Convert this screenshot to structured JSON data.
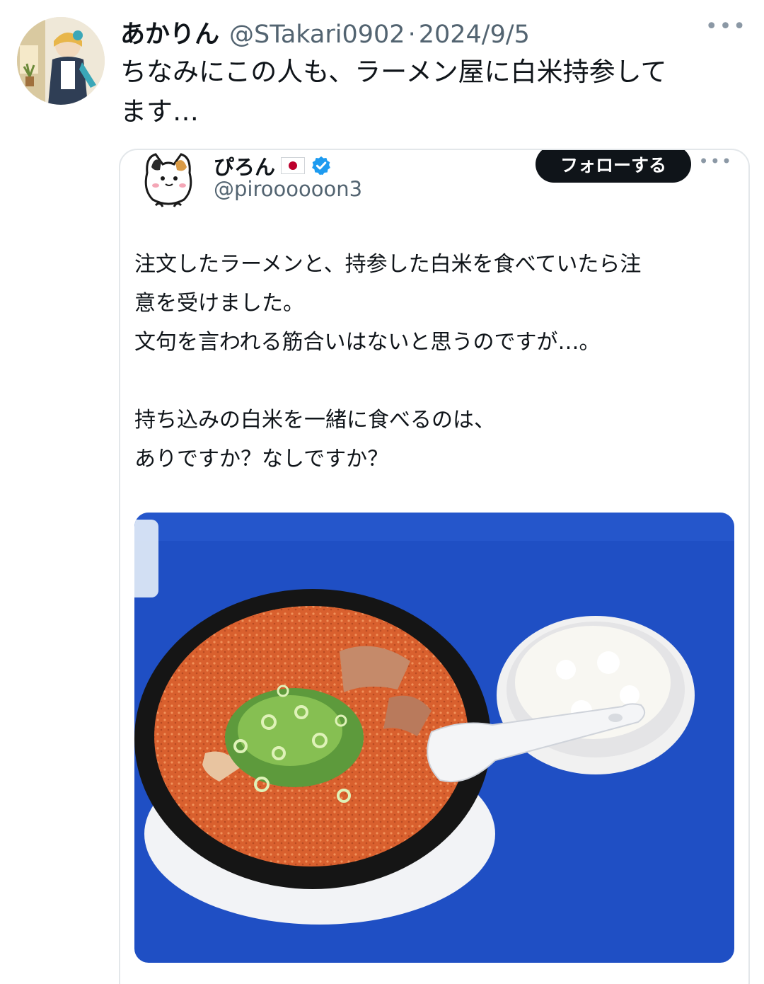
{
  "tweet": {
    "author": {
      "display_name": "あかりん",
      "handle": "@STakari0902",
      "separator": "·",
      "date": "2024/9/5",
      "avatar_icon": "anime-character-avatar"
    },
    "more_label": "•••",
    "text": "ちなみにこの人も、ラーメン屋に白米持参して\nます…"
  },
  "quoted_tweet": {
    "author": {
      "display_name": "ぴろん",
      "flag_icon": "japan-flag-icon",
      "verified_icon": "verified-badge-icon",
      "handle": "@piroooooon3",
      "avatar_icon": "cat-avatar"
    },
    "follow_label": "フォローする",
    "more_label": "•••",
    "text": "注文したラーメンと、持参した白米を食べていたら注\n意を受けました。\n文句を言われる筋合いはないと思うのですが…。\n\n持ち込みの白米を一緒に食べるのは、\nありですか？なしですか？",
    "photo": {
      "description_icon": "ramen-and-rice-photo",
      "colors": {
        "table": "#1f4fc4",
        "soup": "#d9602e",
        "bowl": "#161616",
        "rice": "#f6f4ee"
      }
    }
  },
  "colors": {
    "text_primary": "#0f1419",
    "text_secondary": "#536471",
    "verified_blue": "#1d9bf0",
    "follow_bg": "#0f1419",
    "border": "#e3e7ea"
  }
}
